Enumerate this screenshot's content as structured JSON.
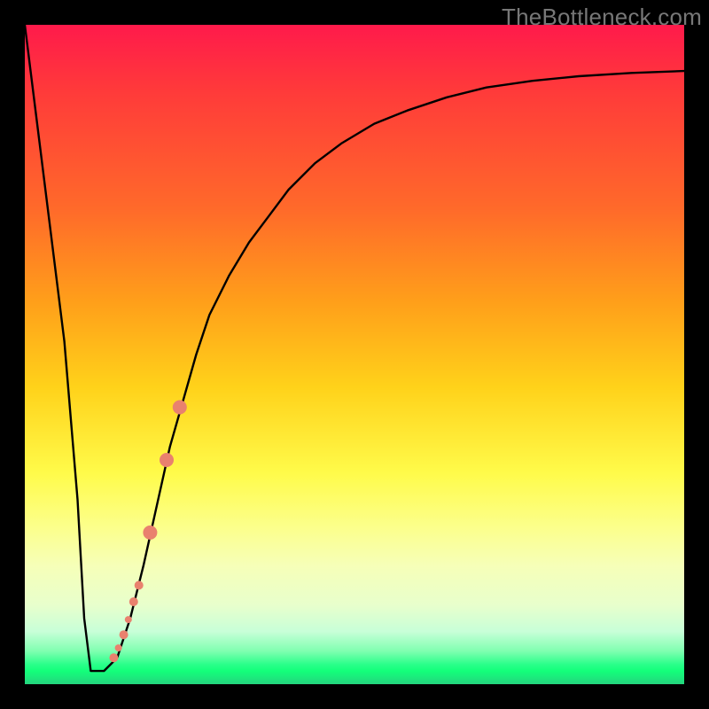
{
  "watermark": "TheBottleneck.com",
  "colors": {
    "curve_stroke": "#000000",
    "marker_fill": "#e9816e",
    "marker_stroke": "#b85a4a",
    "frame_bg": "#000000"
  },
  "chart_data": {
    "type": "line",
    "title": "",
    "xlabel": "",
    "ylabel": "",
    "xlim": [
      0,
      100
    ],
    "ylim": [
      0,
      100
    ],
    "grid": false,
    "series": [
      {
        "name": "bottleneck-curve",
        "x": [
          0,
          6,
          8,
          9,
          10,
          11,
          12,
          14,
          16,
          18,
          20,
          22,
          24,
          26,
          28,
          31,
          34,
          37,
          40,
          44,
          48,
          53,
          58,
          64,
          70,
          77,
          84,
          92,
          100
        ],
        "values": [
          100,
          52,
          28,
          10,
          2,
          2,
          2,
          4,
          10,
          18,
          27,
          36,
          43,
          50,
          56,
          62,
          67,
          71,
          75,
          79,
          82,
          85,
          87,
          89,
          90.5,
          91.5,
          92.2,
          92.7,
          93
        ]
      }
    ],
    "markers": [
      {
        "x": 13.5,
        "y": 4.0,
        "r": 5
      },
      {
        "x": 14.2,
        "y": 5.5,
        "r": 4
      },
      {
        "x": 15.0,
        "y": 7.5,
        "r": 5
      },
      {
        "x": 15.7,
        "y": 9.8,
        "r": 4
      },
      {
        "x": 16.5,
        "y": 12.5,
        "r": 5
      },
      {
        "x": 17.3,
        "y": 15.0,
        "r": 5
      },
      {
        "x": 19.0,
        "y": 23.0,
        "r": 8
      },
      {
        "x": 21.5,
        "y": 34.0,
        "r": 8
      },
      {
        "x": 23.5,
        "y": 42.0,
        "r": 8
      }
    ]
  }
}
